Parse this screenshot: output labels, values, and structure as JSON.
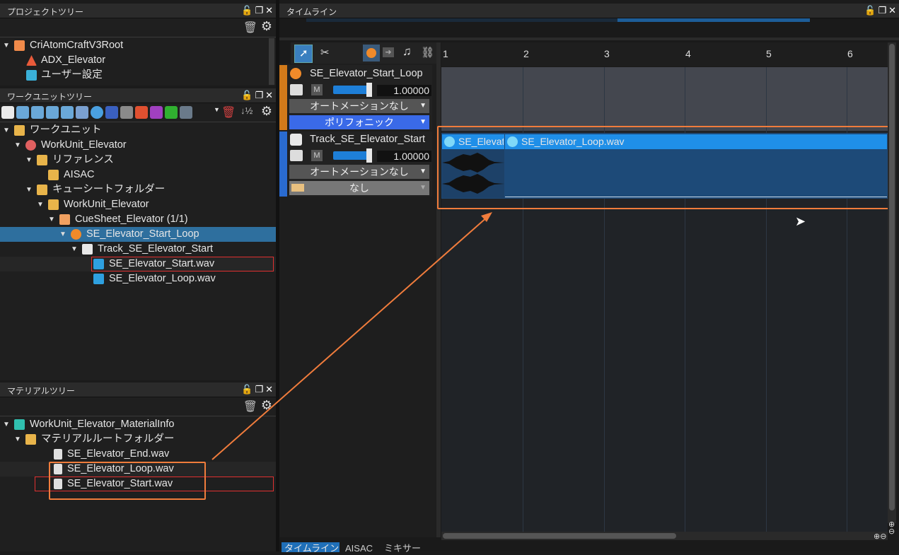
{
  "project_tree": {
    "title": "プロジェクトツリー",
    "root": "CriAtomCraftV3Root",
    "items": [
      "ADX_Elevator",
      "ユーザー設定"
    ]
  },
  "workunit_tree": {
    "title": "ワークユニットツリー",
    "items": [
      {
        "label": "ワークユニット"
      },
      {
        "label": "WorkUnit_Elevator"
      },
      {
        "label": "リファレンス"
      },
      {
        "label": "AISAC"
      },
      {
        "label": "キューシートフォルダー"
      },
      {
        "label": "WorkUnit_Elevator"
      },
      {
        "label": "CueSheet_Elevator (1/1)"
      },
      {
        "label": "SE_Elevator_Start_Loop"
      },
      {
        "label": "Track_SE_Elevator_Start"
      },
      {
        "label": "SE_Elevator_Start.wav"
      },
      {
        "label": "SE_Elevator_Loop.wav"
      }
    ]
  },
  "material_tree": {
    "title": "マテリアルツリー",
    "items": [
      {
        "label": "WorkUnit_Elevator_MaterialInfo"
      },
      {
        "label": "マテリアルルートフォルダー"
      },
      {
        "label": "SE_Elevator_End.wav"
      },
      {
        "label": "SE_Elevator_Loop.wav"
      },
      {
        "label": "SE_Elevator_Start.wav"
      }
    ]
  },
  "timeline": {
    "title": "タイムライン",
    "ruler": [
      "1",
      "2",
      "3",
      "4",
      "5",
      "6"
    ],
    "cue": {
      "name": "SE_Elevator_Start_Loop",
      "m_label": "M",
      "volume": "1.00000",
      "volume_fraction": 0.9,
      "automation": "オートメーションなし",
      "mode": "ポリフォニック"
    },
    "track": {
      "name": "Track_SE_Elevator_Start",
      "m_label": "M",
      "volume": "1.00000",
      "volume_fraction": 0.9,
      "automation": "オートメーションなし",
      "option": "なし"
    },
    "clips": [
      {
        "label": "SE_Elevat"
      },
      {
        "label": "SE_Elevator_Loop.wav"
      }
    ]
  },
  "bottom_tabs": [
    "タイムライン",
    "AISAC",
    "ミキサー"
  ],
  "colors": {
    "accent_blue": "#1e90e8",
    "highlight_orange": "#f07c3c",
    "selection": "#2e6f9e",
    "track_bg": "#1e4a78"
  }
}
